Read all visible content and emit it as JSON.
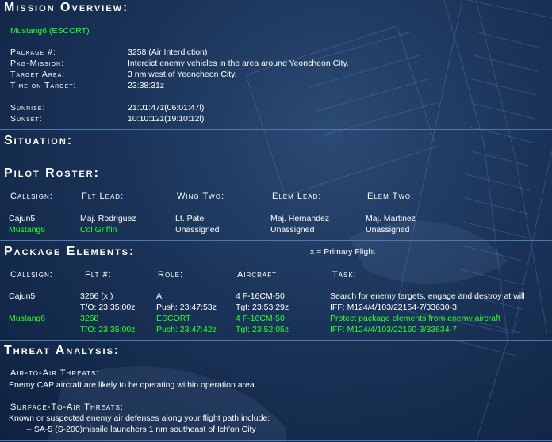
{
  "overview": {
    "heading": "Mission Overview:",
    "flight_id": "Mustang6 (ESCORT)",
    "rows": [
      {
        "label": "Package #:",
        "value": "3258 (Air Interdiction)"
      },
      {
        "label": "Pkg-Mission:",
        "value": "Interdict enemy vehicles in the area around Yeoncheon City."
      },
      {
        "label": "Target Area:",
        "value": "3 nm west of Yeoncheon City."
      },
      {
        "label": "Time on Target:",
        "value": "23:38:31z"
      },
      {
        "label": "Sunrise:",
        "value": "21:01:47z(06:01:47l)"
      },
      {
        "label": "Sunset:",
        "value": "10:10:12z(19:10:12l)"
      }
    ]
  },
  "situation": {
    "heading": "Situation:"
  },
  "roster": {
    "heading": "Pilot Roster:",
    "columns": [
      "Callsign:",
      "Flt Lead:",
      "Wing Two:",
      "Elem Lead:",
      "Elem Two:"
    ],
    "rows": [
      {
        "cells": [
          "Cajun5",
          "Maj. Rodriguez",
          "Lt. Patel",
          "Maj. Hernandez",
          "Maj. Martinez"
        ],
        "highlight": false
      },
      {
        "cells": [
          "Mustang6",
          "Col Griffin",
          "Unassigned",
          "Unassigned",
          "Unassigned"
        ],
        "highlight": true
      }
    ]
  },
  "package": {
    "heading": "Package Elements:",
    "legend": "x  = Primary Flight",
    "columns": [
      "Callsign:",
      "Flt #:",
      "Role:",
      "Aircraft:",
      "Task:"
    ],
    "rows": [
      {
        "callsign": "Cajun5",
        "flt": "3266 (x )",
        "flt2": "T/O: 23:35:00z",
        "role": "AI",
        "role2": "Push: 23:47:53z",
        "aircraft": "4 F-16CM-50",
        "aircraft2": "Tgt: 23:53:29z",
        "task": "Search for enemy targets, engage and destroy at will",
        "task2": "IFF: M124/4/103/22154-7/33630-3",
        "highlight": false
      },
      {
        "callsign": "Mustang6",
        "flt": "3268",
        "flt2": "T/O: 23:35:00z",
        "role": "ESCORT",
        "role2": "Push: 23:47:42z",
        "aircraft": "4 F-16CM-50",
        "aircraft2": "Tgt: 23:52:05z",
        "task": "Protect package elements from enemy aircraft",
        "task2": "IFF: M124/4/103/22160-3/33634-7",
        "highlight": true
      }
    ]
  },
  "threat": {
    "heading": "Threat Analysis:",
    "a2a_heading": "Air-to-Air Threats:",
    "a2a_text": "Enemy CAP aircraft are likely to be operating within operation area.",
    "s2a_heading": "Surface-To-Air Threats:",
    "s2a_text": "Known or suspected enemy air defenses along your flight path include:",
    "s2a_item": "-- SA-5 (S-200)missile launchers 1 nm southeast of Ich'on City"
  },
  "colors": {
    "highlight": "#2aff2a",
    "rule": "#4d77b3",
    "text": "#ffffff"
  }
}
